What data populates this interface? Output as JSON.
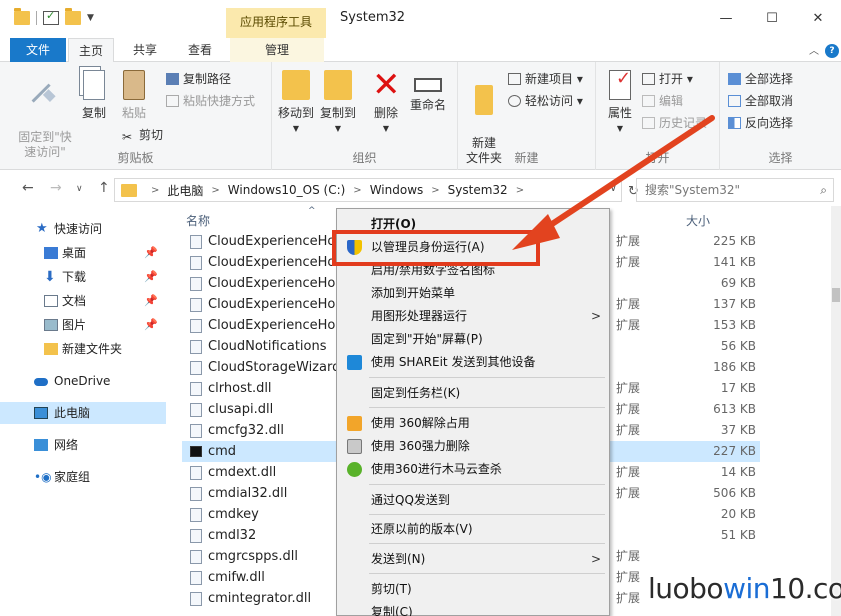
{
  "titlebar": {
    "tools_tab": "应用程序工具",
    "title": "System32",
    "minimize": "—",
    "maximize": "☐",
    "close": "✕"
  },
  "tabs": {
    "file": "文件",
    "home": "主页",
    "share": "共享",
    "view": "查看",
    "manage": "管理"
  },
  "ribbon": {
    "clipboard": {
      "label": "剪贴板",
      "pin": "固定到\"快\n速访问\"",
      "copy": "复制",
      "paste": "粘贴",
      "copy_path": "复制路径",
      "paste_shortcut": "粘贴快捷方式",
      "cut": "剪切"
    },
    "organize": {
      "label": "组织",
      "move_to": "移动到",
      "copy_to": "复制到",
      "delete": "删除",
      "rename": "重命名"
    },
    "new": {
      "label": "新建",
      "new_folder": "新建\n文件夹",
      "new_item": "新建项目",
      "easy_access": "轻松访问"
    },
    "open": {
      "label": "打开",
      "properties": "属性",
      "open": "打开",
      "edit": "编辑",
      "history": "历史记录"
    },
    "select": {
      "label": "选择",
      "select_all": "全部选择",
      "select_none": "全部取消",
      "invert": "反向选择"
    }
  },
  "address": {
    "crumbs": [
      "此电脑",
      "Windows10_OS (C:)",
      "Windows",
      "System32"
    ],
    "search_placeholder": "搜索\"System32\""
  },
  "nav": {
    "quick_access": "快速访问",
    "desktop": "桌面",
    "downloads": "下载",
    "documents": "文档",
    "pictures": "图片",
    "new_folder": "新建文件夹",
    "onedrive": "OneDrive",
    "this_pc": "此电脑",
    "network": "网络",
    "homegroup": "家庭组"
  },
  "list": {
    "col_name": "名称",
    "col_size": "大小",
    "files": [
      {
        "name": "CloudExperienceHos",
        "type": "扩展",
        "size": "225 KB"
      },
      {
        "name": "CloudExperienceHos",
        "type": "扩展",
        "size": "141 KB"
      },
      {
        "name": "CloudExperienceHostE",
        "type": "",
        "size": "69 KB"
      },
      {
        "name": "CloudExperienceHostC",
        "type": "扩展",
        "size": "137 KB"
      },
      {
        "name": "CloudExperienceHostU",
        "type": "扩展",
        "size": "153 KB"
      },
      {
        "name": "CloudNotifications",
        "type": "",
        "size": "56 KB"
      },
      {
        "name": "CloudStorageWizard",
        "type": "",
        "size": "186 KB"
      },
      {
        "name": "clrhost.dll",
        "type": "扩展",
        "size": "17 KB"
      },
      {
        "name": "clusapi.dll",
        "type": "扩展",
        "size": "613 KB"
      },
      {
        "name": "cmcfg32.dll",
        "type": "扩展",
        "size": "37 KB"
      },
      {
        "name": "cmd",
        "type": "",
        "size": "227 KB"
      },
      {
        "name": "cmdext.dll",
        "type": "扩展",
        "size": "14 KB"
      },
      {
        "name": "cmdial32.dll",
        "type": "扩展",
        "size": "506 KB"
      },
      {
        "name": "cmdkey",
        "type": "",
        "size": "20 KB"
      },
      {
        "name": "cmdl32",
        "type": "",
        "size": "51 KB"
      },
      {
        "name": "cmgrcspps.dll",
        "type": "扩展",
        "size": ""
      },
      {
        "name": "cmifw.dll",
        "type": "扩展",
        "size": ""
      },
      {
        "name": "cmintegrator.dll",
        "type": "扩展",
        "size": ""
      }
    ]
  },
  "context_menu": {
    "open": "打开(O)",
    "run_as_admin": "以管理员身份运行(A)",
    "toggle_signature": "启用/禁用数字签名图标",
    "add_to_start": "添加到开始菜单",
    "run_with_gpu": "用图形处理器运行",
    "pin_to_start": "固定到\"开始\"屏幕(P)",
    "shareit": "使用 SHAREit 发送到其他设备",
    "pin_to_taskbar": "固定到任务栏(K)",
    "unlock_360": "使用 360解除占用",
    "force_delete_360": "使用 360强力删除",
    "trojan_scan_360": "使用360进行木马云查杀",
    "send_qq": "通过QQ发送到",
    "restore_previous": "还原以前的版本(V)",
    "send_to": "发送到(N)",
    "cut": "剪切(T)",
    "copy": "复制(C)"
  },
  "watermark": {
    "prefix": "luobo",
    "win": "win",
    "suffix": "10.com"
  },
  "colors": {
    "accent": "#1979ca",
    "highlight_border": "#e23b1d",
    "selection": "#cce8ff"
  }
}
